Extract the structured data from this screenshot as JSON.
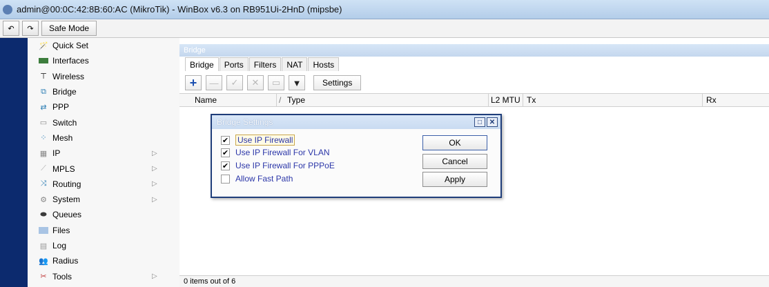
{
  "window": {
    "title": "admin@00:0C:42:8B:60:AC (MikroTik) - WinBox v6.3 on RB951Ui-2HnD (mipsbe)"
  },
  "toolbar": {
    "undo_icon": "undo-icon",
    "redo_icon": "redo-icon",
    "safe_mode_label": "Safe Mode"
  },
  "sidebar": {
    "items": [
      {
        "label": "Quick Set",
        "icon": "quick-set-icon",
        "arrow": false
      },
      {
        "label": "Interfaces",
        "icon": "interfaces-icon",
        "arrow": false
      },
      {
        "label": "Wireless",
        "icon": "wireless-icon",
        "arrow": false
      },
      {
        "label": "Bridge",
        "icon": "bridge-icon",
        "arrow": false
      },
      {
        "label": "PPP",
        "icon": "ppp-icon",
        "arrow": false
      },
      {
        "label": "Switch",
        "icon": "switch-icon",
        "arrow": false
      },
      {
        "label": "Mesh",
        "icon": "mesh-icon",
        "arrow": false
      },
      {
        "label": "IP",
        "icon": "ip-icon",
        "arrow": true
      },
      {
        "label": "MPLS",
        "icon": "mpls-icon",
        "arrow": true
      },
      {
        "label": "Routing",
        "icon": "routing-icon",
        "arrow": true
      },
      {
        "label": "System",
        "icon": "system-icon",
        "arrow": true
      },
      {
        "label": "Queues",
        "icon": "queues-icon",
        "arrow": false
      },
      {
        "label": "Files",
        "icon": "files-icon",
        "arrow": false
      },
      {
        "label": "Log",
        "icon": "log-icon",
        "arrow": false
      },
      {
        "label": "Radius",
        "icon": "radius-icon",
        "arrow": false
      },
      {
        "label": "Tools",
        "icon": "tools-icon",
        "arrow": true
      }
    ],
    "arrow_glyph": "▷"
  },
  "bridge_window": {
    "title": "Bridge",
    "tabs": [
      "Bridge",
      "Ports",
      "Filters",
      "NAT",
      "Hosts"
    ],
    "active_tab": "Bridge",
    "settings_label": "Settings",
    "columns": [
      "Name",
      "Type",
      "L2 MTU",
      "Tx",
      "Rx"
    ],
    "sort_glyph": "/",
    "status": "0 items out of 6"
  },
  "dialog": {
    "title": "Bridge Settings",
    "checkboxes": [
      {
        "label": "Use IP Firewall",
        "checked": true
      },
      {
        "label": "Use IP Firewall For VLAN",
        "checked": true
      },
      {
        "label": "Use IP Firewall For PPPoE",
        "checked": true
      },
      {
        "label": "Allow Fast Path",
        "checked": false
      }
    ],
    "buttons": {
      "ok": "OK",
      "cancel": "Cancel",
      "apply": "Apply"
    },
    "controls": {
      "restore": "□",
      "close": "✕"
    },
    "check_glyph": "✔"
  },
  "colors": {
    "accent": "#1e3d7a",
    "strip": "#0c2a6e",
    "link_text": "#2b36a8"
  }
}
